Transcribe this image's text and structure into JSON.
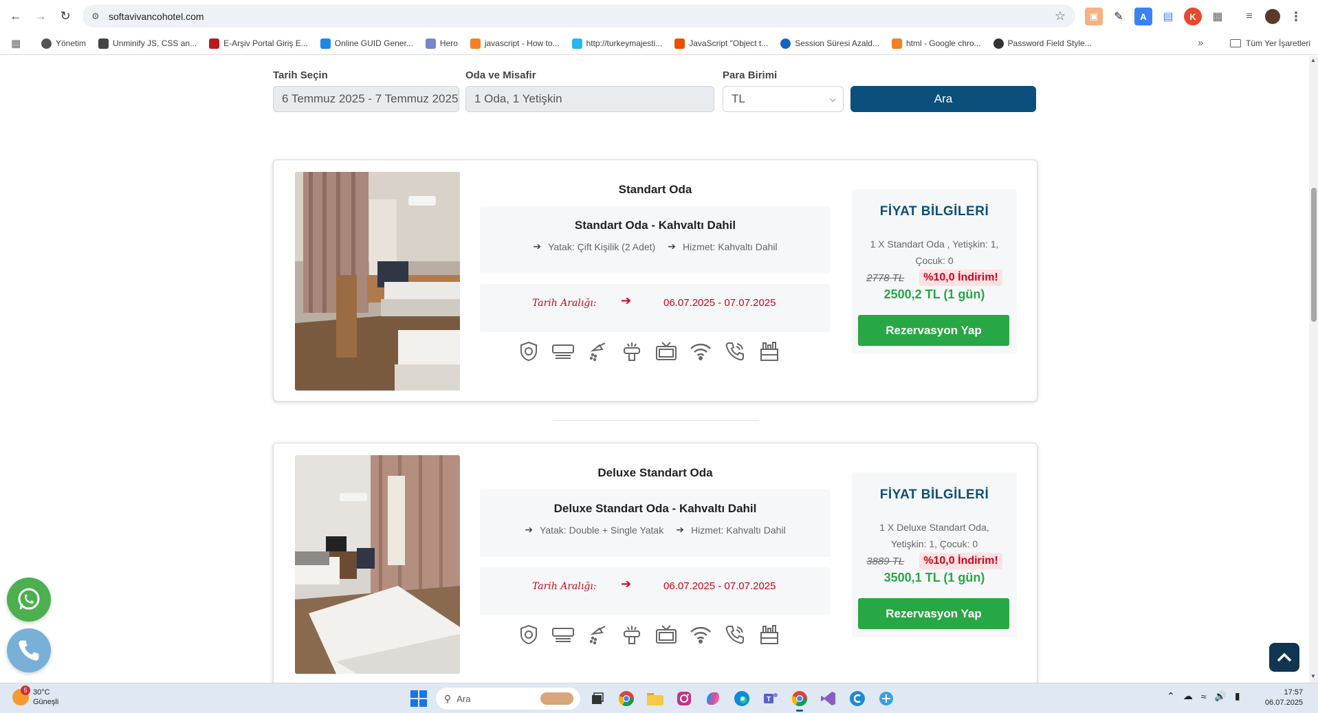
{
  "browser": {
    "url": "softavivancohotel.com",
    "bookmarks": [
      "Yönetim",
      "Unminify JS, CSS an...",
      "E-Arşiv Portal Giriş E...",
      "Online GUID Gener...",
      "Hero",
      "javascript - How to...",
      "http://turkeymajesti...",
      "JavaScript \"Object t...",
      "Session Süresi Azald...",
      "html - Google chro...",
      "Password Field Style..."
    ],
    "all_bookmarks": "Tüm Yer İşaretleri"
  },
  "search": {
    "date_label": "Tarih Seçin",
    "date_value": "6 Temmuz 2025 - 7 Temmuz 2025",
    "guests_label": "Oda ve Misafir",
    "guests_value": "1 Oda, 1 Yetişkin",
    "currency_label": "Para Birimi",
    "currency_value": "TL",
    "search_button": "Ara"
  },
  "rooms": [
    {
      "name": "Standart Oda",
      "package": "Standart Oda - Kahvaltı Dahil",
      "bed": "Yatak: Çift Kişilik (2 Adet)",
      "service": "Hizmet: Kahvaltı Dahil",
      "date_label": "Tarih Aralığı:",
      "date_range": "06.07.2025 - 07.07.2025",
      "price_heading": "FİYAT BİLGİLERİ",
      "price_desc": "1 X Standart Oda , Yetişkin: 1, Çocuk: 0",
      "old_price": "2778 TL",
      "discount": "%10,0 İndirim!",
      "new_price": "2500,2 TL (1 gün)",
      "book_button": "Rezervasyon Yap"
    },
    {
      "name": "Deluxe Standart Oda",
      "package": "Deluxe Standart Oda - Kahvaltı Dahil",
      "bed": "Yatak: Double + Single Yatak",
      "service": "Hizmet: Kahvaltı Dahil",
      "date_label": "Tarih Aralığı:",
      "date_range": "06.07.2025 - 07.07.2025",
      "price_heading": "FİYAT BİLGİLERİ",
      "price_desc": "1 X Deluxe Standart Oda, Yetişkin: 1, Çocuk: 0",
      "old_price": "3889 TL",
      "discount": "%10,0 İndirim!",
      "new_price": "3500,1 TL (1 gün)",
      "book_button": "Rezervasyon Yap"
    }
  ],
  "amenity_icons": [
    "safe-icon",
    "air-conditioner-icon",
    "shower-icon",
    "hair-dryer-icon",
    "tv-icon",
    "wifi-icon",
    "phone-icon",
    "minibar-icon"
  ],
  "taskbar": {
    "temperature": "30°C",
    "weather": "Güneşli",
    "weather_badge": "5",
    "search_placeholder": "Ara",
    "time": "17:57",
    "date": "06.07.2025"
  },
  "colors": {
    "primary": "#0b4f7c",
    "success": "#28a745",
    "danger": "#d0021b"
  }
}
